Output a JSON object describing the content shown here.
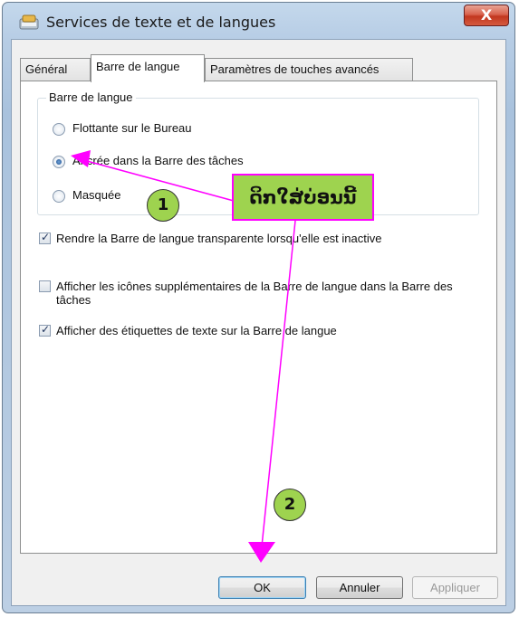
{
  "window": {
    "title": "Services de texte et de langues",
    "close_label": "X"
  },
  "tabs": [
    {
      "label": "Général"
    },
    {
      "label": "Barre de langue"
    },
    {
      "label": "Paramètres de touches avancés"
    }
  ],
  "group": {
    "label": "Barre de langue",
    "options": [
      {
        "label": "Flottante sur le Bureau",
        "selected": false
      },
      {
        "label": "Ancrée dans la Barre des tâches",
        "selected": true
      },
      {
        "label": "Masquée",
        "selected": false
      }
    ]
  },
  "checkboxes": [
    {
      "label": "Rendre la Barre de langue transparente lorsqu'elle est inactive",
      "checked": true
    },
    {
      "label": "Afficher les icônes supplémentaires de la Barre de langue dans la Barre des tâches",
      "checked": false
    },
    {
      "label": "Afficher des étiquettes de texte sur la Barre de langue",
      "checked": true
    }
  ],
  "buttons": {
    "ok": "OK",
    "cancel": "Annuler",
    "apply": "Appliquer"
  },
  "annotations": {
    "callout": "ດິກໃສ່ບ່ອນນີ້",
    "step1": "1",
    "step2": "2",
    "color": "#ff00ff",
    "badge_color": "#9ed34f"
  }
}
